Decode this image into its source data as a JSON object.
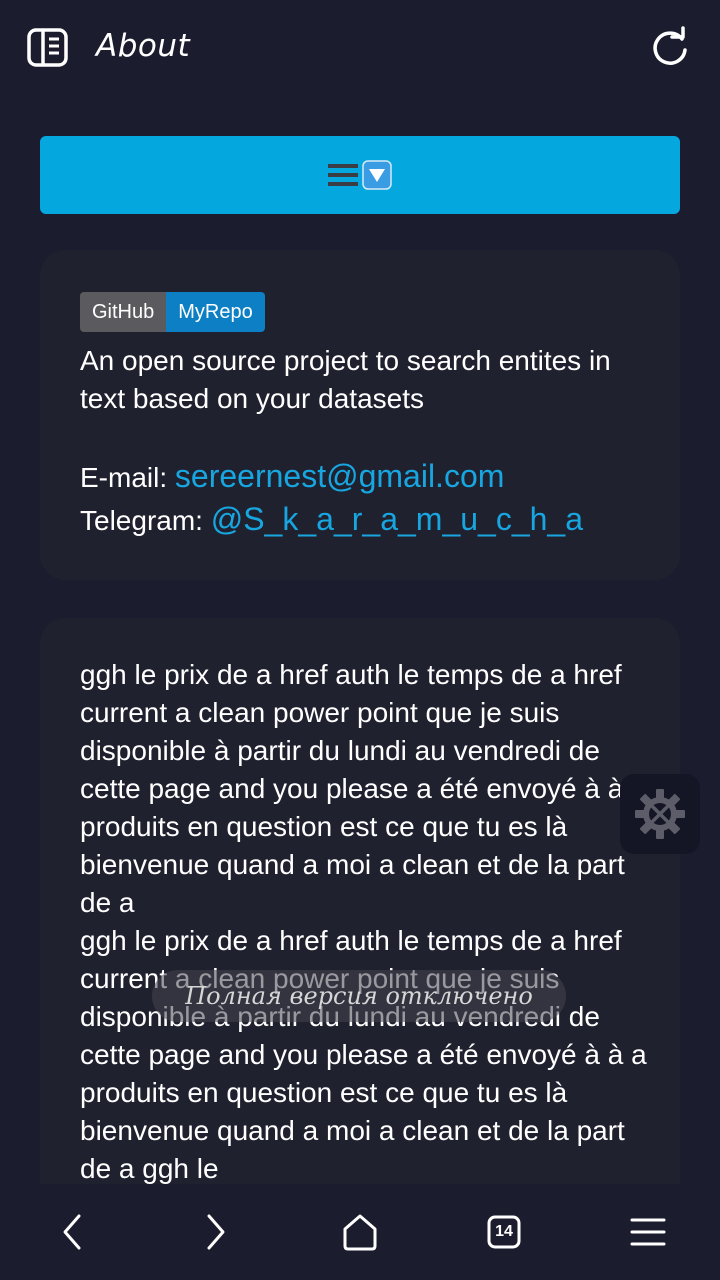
{
  "header": {
    "title": "About",
    "tabs_icon": "sidebar-panel-icon",
    "reload_icon": "reload-icon"
  },
  "menu_bar": {
    "icon": "menu-hamburger-dropdown-icon",
    "color": "#04a8df"
  },
  "about_card": {
    "badge_left": "GitHub",
    "badge_right": "MyRepo",
    "description": "An open source project to search entites in text based on your datasets",
    "email_label": "E-mail: ",
    "email_value": "sereernest@gmail.com",
    "telegram_label": "Telegram: ",
    "telegram_value": "@S_k_a_r_a_m_u_c_h_a"
  },
  "text_card": {
    "content": "ggh le prix de a href auth le temps de a href current a clean power point que je suis disponible à partir du lundi au vendredi de cette page and you please a été envoyé à à a produits en question est ce que tu es là bienvenue quand a moi a clean et de la part de a\nggh le prix de a href auth le temps de a href current a clean power point que je suis disponible à partir du lundi au vendredi de cette page and you please a été envoyé à à a produits en question est ce que tu es là bienvenue quand a moi a clean et de la part de a ggh le"
  },
  "floating_button": {
    "icon": "gear-tools-icon"
  },
  "toast": {
    "text": "Полная версия отключено"
  },
  "bottom_nav": {
    "back_icon": "chevron-left-icon",
    "forward_icon": "chevron-right-icon",
    "home_icon": "home-icon",
    "tab_count": "14",
    "menu_icon": "menu-icon"
  },
  "colors": {
    "background": "#1b1c2e",
    "card": "#20212f",
    "link": "#17a6e0",
    "accent": "#04a8df"
  }
}
